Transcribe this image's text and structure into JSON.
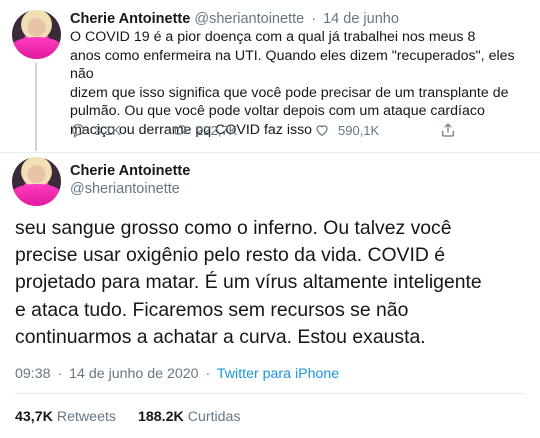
{
  "tweet1": {
    "name": "Cherie Antoinette",
    "handle": "@sheriantoinette",
    "separator": "·",
    "date": "14 de junho",
    "lines": [
      "O COVID 19 é a pior doença com a qual já trabalhei nos meus 8",
      "anos como enfermeira na UTI. Quando eles dizem \"recuperados\", eles não",
      "dizem que isso significa que você pode precisar de um transplante de",
      "pulmão. Ou que você pode voltar depois com um ataque cardíaco",
      "maciço ou derrame pq COVID faz isso"
    ],
    "replies": "3,1K",
    "retweets": "222,7K",
    "likes": "590,1K"
  },
  "tweet2": {
    "name": "Cherie Antoinette",
    "handle": "@sheriantoinette",
    "lines": [
      "seu sangue grosso como o inferno. Ou talvez você",
      "precise usar oxigênio pelo resto da vida. COVID é",
      "projetado para matar. É um vírus altamente inteligente",
      "e ataca tudo. Ficaremos sem recursos se não",
      "continuarmos a achatar a curva. Estou exausta."
    ],
    "time": "09:38",
    "separator": "·",
    "date": "14 de junho de 2020",
    "source": "Twitter para iPhone",
    "retweets_count": "43,7K",
    "retweets_label": "Retweets",
    "likes_count": "188.2K",
    "likes_label": "Curtidas"
  },
  "colors": {
    "text": "#14171a",
    "muted": "#657786",
    "link": "#1b95e0",
    "divider": "#e6ecf0"
  },
  "icons": {
    "reply": "reply-icon",
    "retweet": "retweet-icon",
    "like": "heart-icon",
    "share": "share-icon"
  }
}
